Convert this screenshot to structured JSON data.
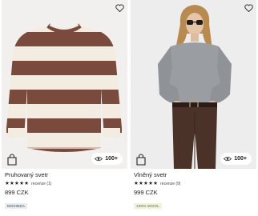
{
  "products": [
    {
      "name": "Pruhovaný svetr",
      "stars": "★★★★★",
      "reviews": "recenze (1)",
      "price": "899 CZK",
      "tag": "NOVINKA",
      "view_count": "100+",
      "icons": [
        "heart-icon",
        "shopping-bag-icon",
        "eye-icon"
      ]
    },
    {
      "name": "Vlněný svetr",
      "stars": "★★★★★",
      "reviews": "recenze (9)",
      "price": "999 CZK",
      "tag": "100% WOOL",
      "view_count": "100+",
      "icons": [
        "heart-icon",
        "shopping-bag-icon",
        "eye-icon"
      ]
    }
  ],
  "colors": {
    "stripe_brown": "#7a4b3c",
    "stripe_cream": "#f3ece1",
    "sweater_grey": "#9a9ea3",
    "trousers_brown": "#4a3228",
    "tag_new_bg": "#e8ecef",
    "tag_wool_bg": "#eef3df"
  }
}
